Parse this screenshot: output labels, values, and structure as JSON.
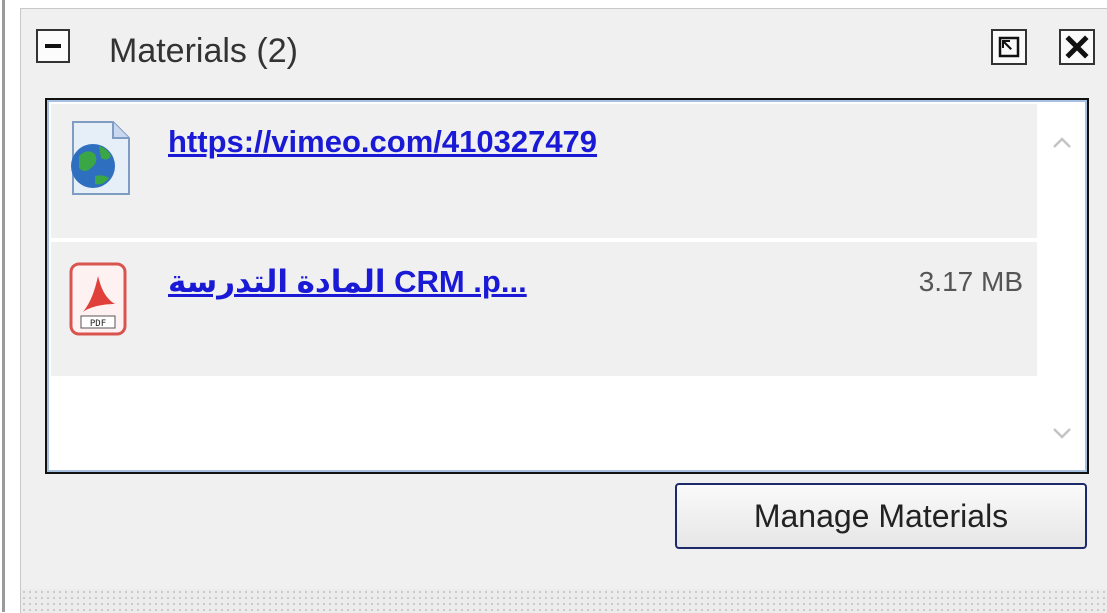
{
  "panel": {
    "title": "Materials (2)",
    "collapse_icon": "minus-icon",
    "popout_icon": "popout-icon",
    "close_icon": "close-icon"
  },
  "materials": [
    {
      "type": "link",
      "icon": "web-link-globe-icon",
      "label": "https://vimeo.com/410327479",
      "size": ""
    },
    {
      "type": "pdf",
      "icon": "pdf-file-icon",
      "label": "المادة التدرسة  CRM   .p...",
      "size": "3.17 MB"
    }
  ],
  "scrollbar": {
    "up_icon": "chevron-up-icon",
    "down_icon": "chevron-down-icon"
  },
  "manage_button": {
    "label": "Manage Materials"
  },
  "colors": {
    "link": "#1a1ad6",
    "row_bg": "#f0f0f0",
    "panel_bg": "#f0f0f0",
    "button_border": "#1c2a6b"
  }
}
